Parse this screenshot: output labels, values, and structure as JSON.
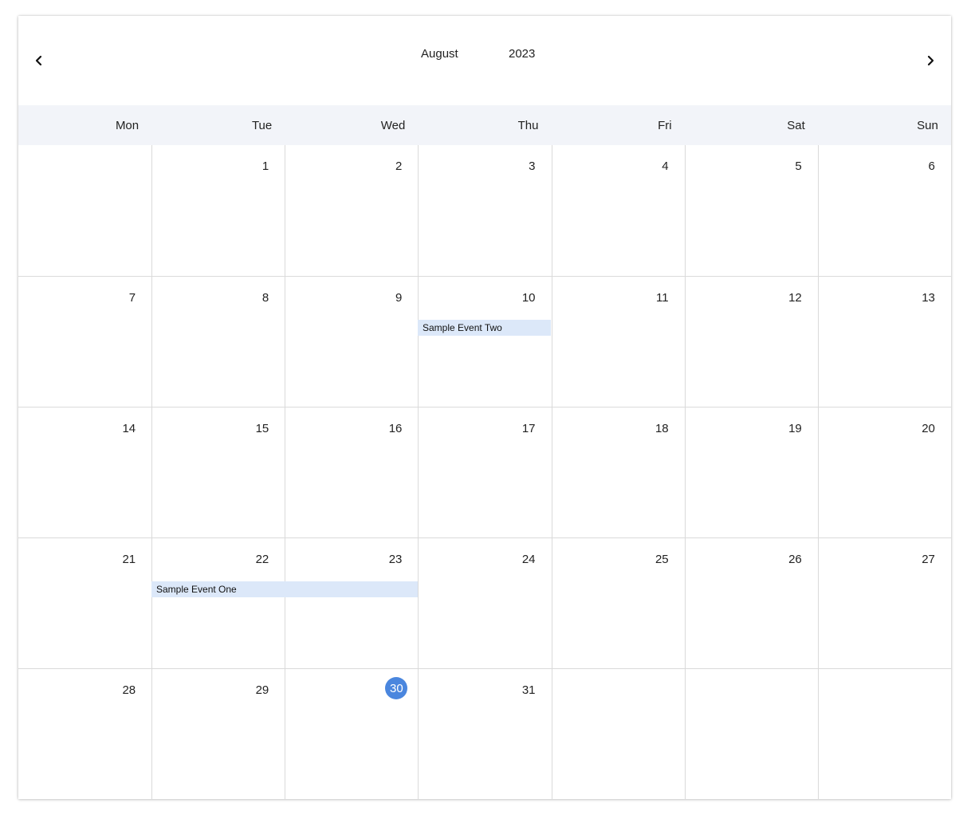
{
  "header": {
    "month": "August",
    "year": "2023",
    "prev_icon": "chevron-left-icon",
    "next_icon": "chevron-right-icon"
  },
  "weekdays": [
    "Mon",
    "Tue",
    "Wed",
    "Thu",
    "Fri",
    "Sat",
    "Sun"
  ],
  "weeks": [
    [
      "",
      "1",
      "2",
      "3",
      "4",
      "5",
      "6"
    ],
    [
      "7",
      "8",
      "9",
      "10",
      "11",
      "12",
      "13"
    ],
    [
      "14",
      "15",
      "16",
      "17",
      "18",
      "19",
      "20"
    ],
    [
      "21",
      "22",
      "23",
      "24",
      "25",
      "26",
      "27"
    ],
    [
      "28",
      "29",
      "30",
      "31",
      "",
      "",
      ""
    ]
  ],
  "today": "30",
  "events": [
    {
      "title": "Sample Event Two",
      "start": "10",
      "end": "10"
    },
    {
      "title": "Sample Event One",
      "start": "22",
      "end": "23"
    }
  ],
  "colors": {
    "today_badge": "#4a86de",
    "event_bg": "#dce8f9",
    "weekday_row_bg": "#f2f4f9",
    "grid_line": "#dadada"
  }
}
